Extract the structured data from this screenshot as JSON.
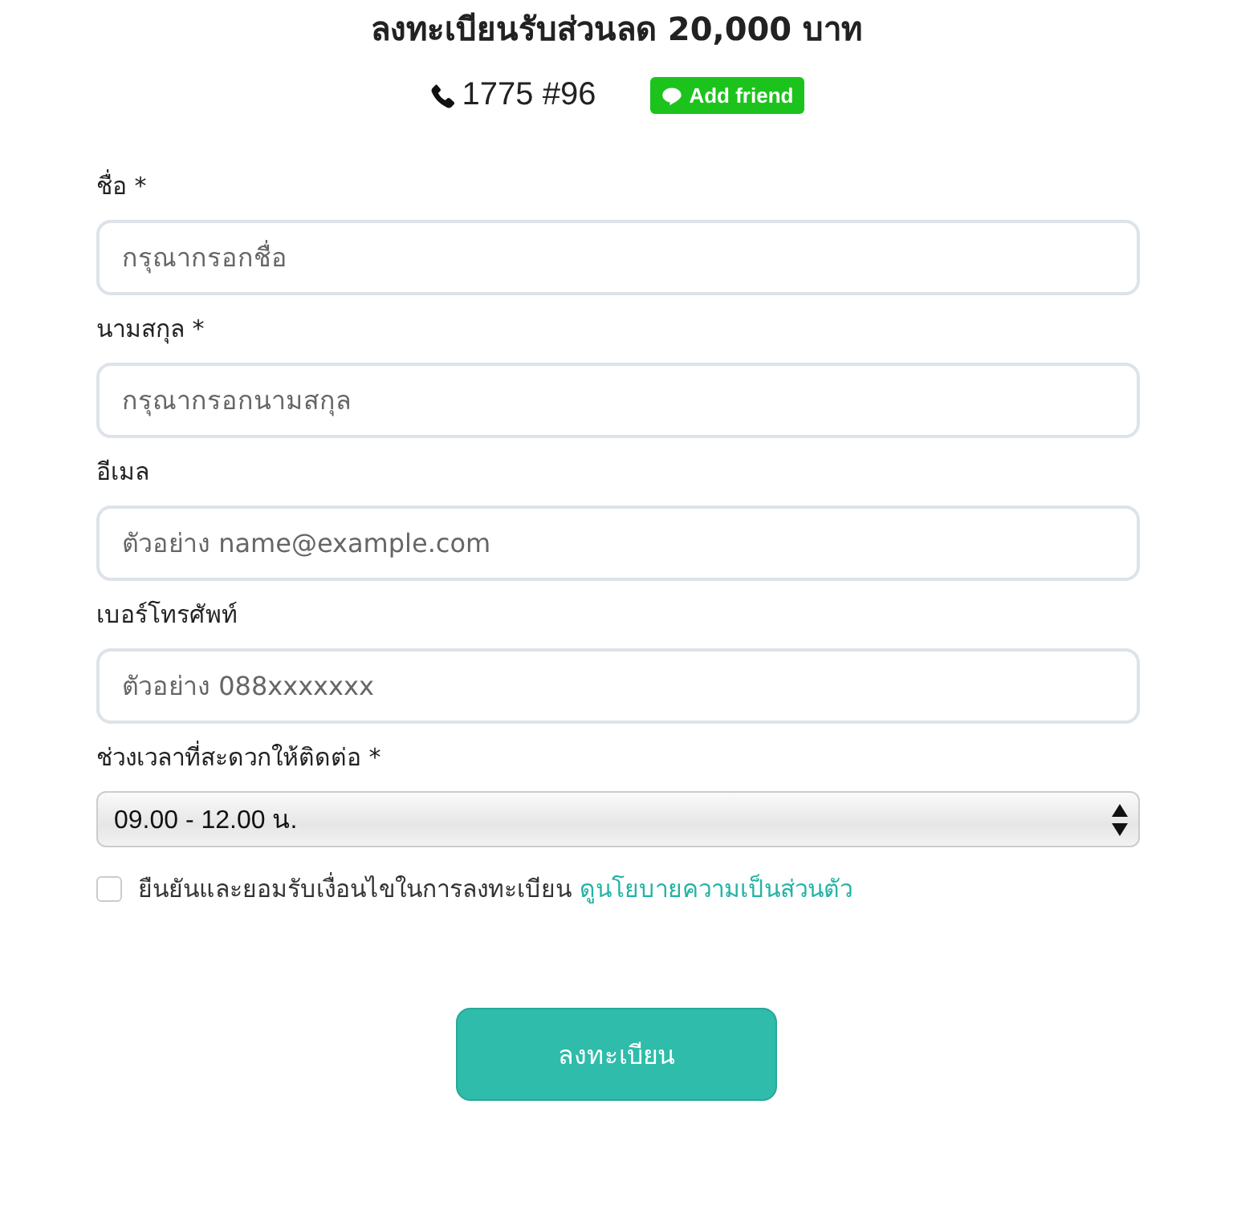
{
  "title": "ลงทะเบียนรับส่วนลด 20,000 บาท",
  "contact": {
    "phone": "1775 #96",
    "add_friend": "Add friend"
  },
  "fields": [
    {
      "kind": "text",
      "label": "ชื่อ *",
      "placeholder": "กรุณากรอกชื่อ"
    },
    {
      "kind": "text",
      "label": "นามสกุล *",
      "placeholder": "กรุณากรอกนามสกุล"
    },
    {
      "kind": "text",
      "label": "อีเมล",
      "placeholder": "ตัวอย่าง name@example.com"
    },
    {
      "kind": "text",
      "label": "เบอร์โทรศัพท์",
      "placeholder": "ตัวอย่าง 088xxxxxxx"
    },
    {
      "kind": "select",
      "label": "ช่วงเวลาที่สะดวกให้ติดต่อ *",
      "value": "09.00 - 12.00 น."
    }
  ],
  "consent": {
    "checked": false,
    "text": "ยืนยันและยอมรับเงื่อนไขในการลงทะเบียน",
    "link": "ดูนโยบายความเป็นส่วนตัว"
  },
  "submit": "ลงทะเบียน"
}
